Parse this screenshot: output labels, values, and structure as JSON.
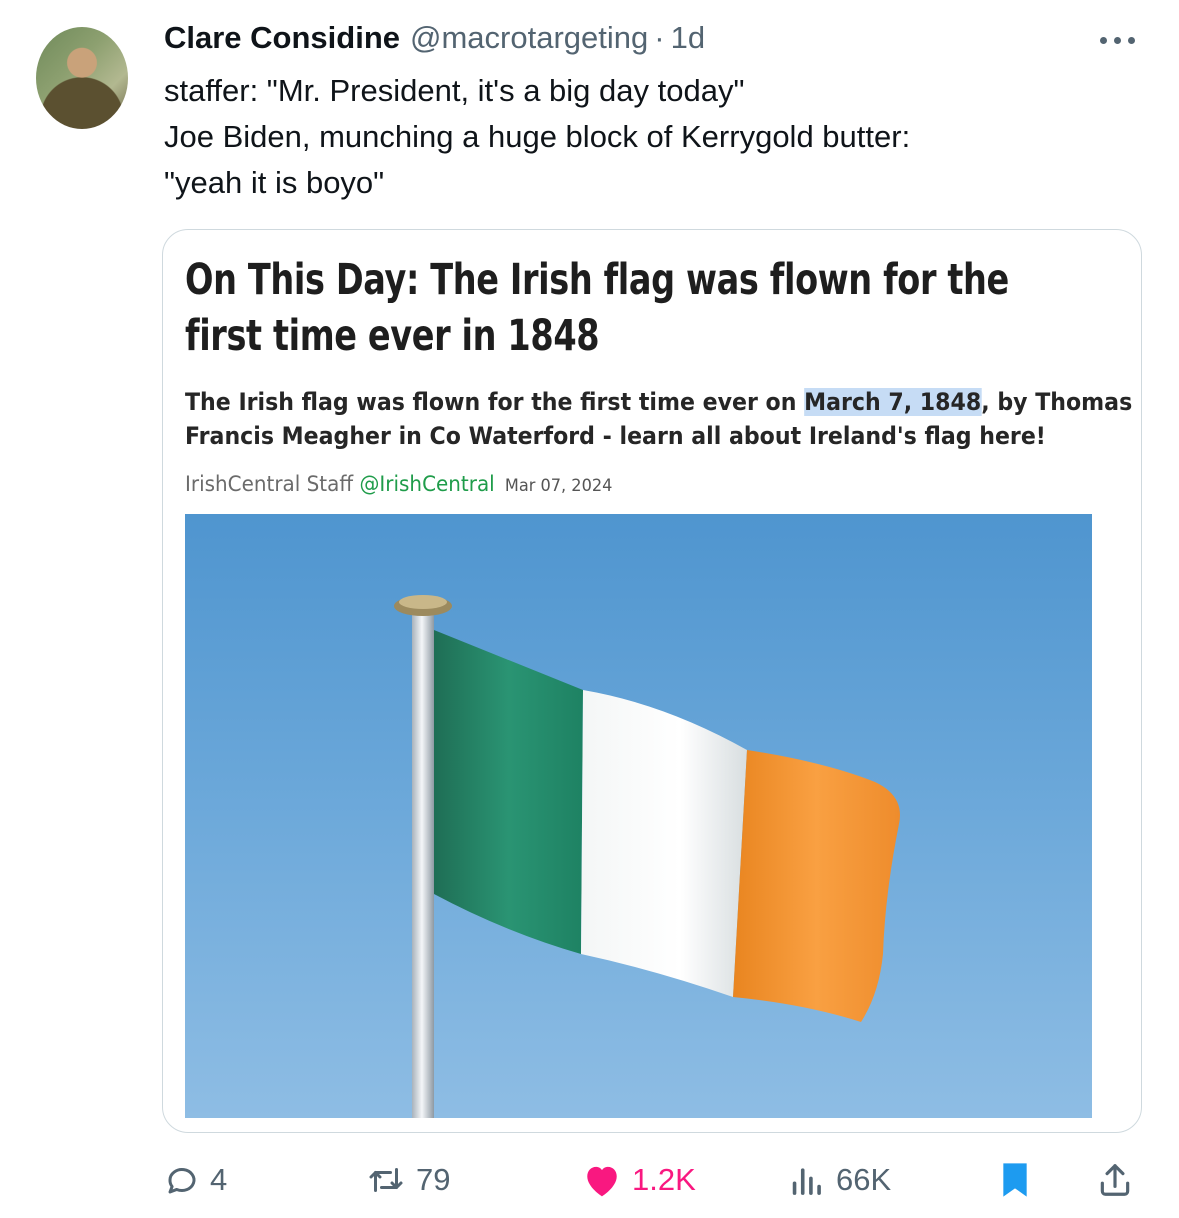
{
  "tweet": {
    "author_name": "Clare Considine",
    "handle": "@macrotargeting",
    "separator": "·",
    "time": "1d",
    "text_lines": [
      "staffer: \"Mr. President, it's a big day today\"",
      "Joe Biden, munching a huge block of Kerrygold butter:",
      "\"yeah it is boyo\""
    ]
  },
  "card": {
    "title_lines": [
      "On This Day: The Irish flag was flown for the",
      "first time ever in 1848"
    ],
    "desc_line1_before": "The Irish flag was flown for the first time ever on ",
    "desc_line1_highlight": "March 7, 1848",
    "desc_line1_after": ", by Thomas",
    "desc_line2": "Francis Meagher in Co Waterford - learn all about Ireland's flag here!",
    "byline_author": "IrishCentral Staff",
    "byline_handle": "@IrishCentral",
    "byline_date": "Mar 07, 2024"
  },
  "actions": {
    "replies": "4",
    "reposts": "79",
    "likes": "1.2K",
    "views": "66K"
  },
  "colors": {
    "like": "#f91880",
    "bookmark": "#1d9bf0",
    "secondary_text": "#536471",
    "flag_green": "#169b62",
    "flag_white": "#ffffff",
    "flag_orange": "#ff883e"
  },
  "icons": [
    "more-icon",
    "reply-icon",
    "repost-icon",
    "like-icon",
    "views-icon",
    "bookmark-icon",
    "share-icon"
  ]
}
